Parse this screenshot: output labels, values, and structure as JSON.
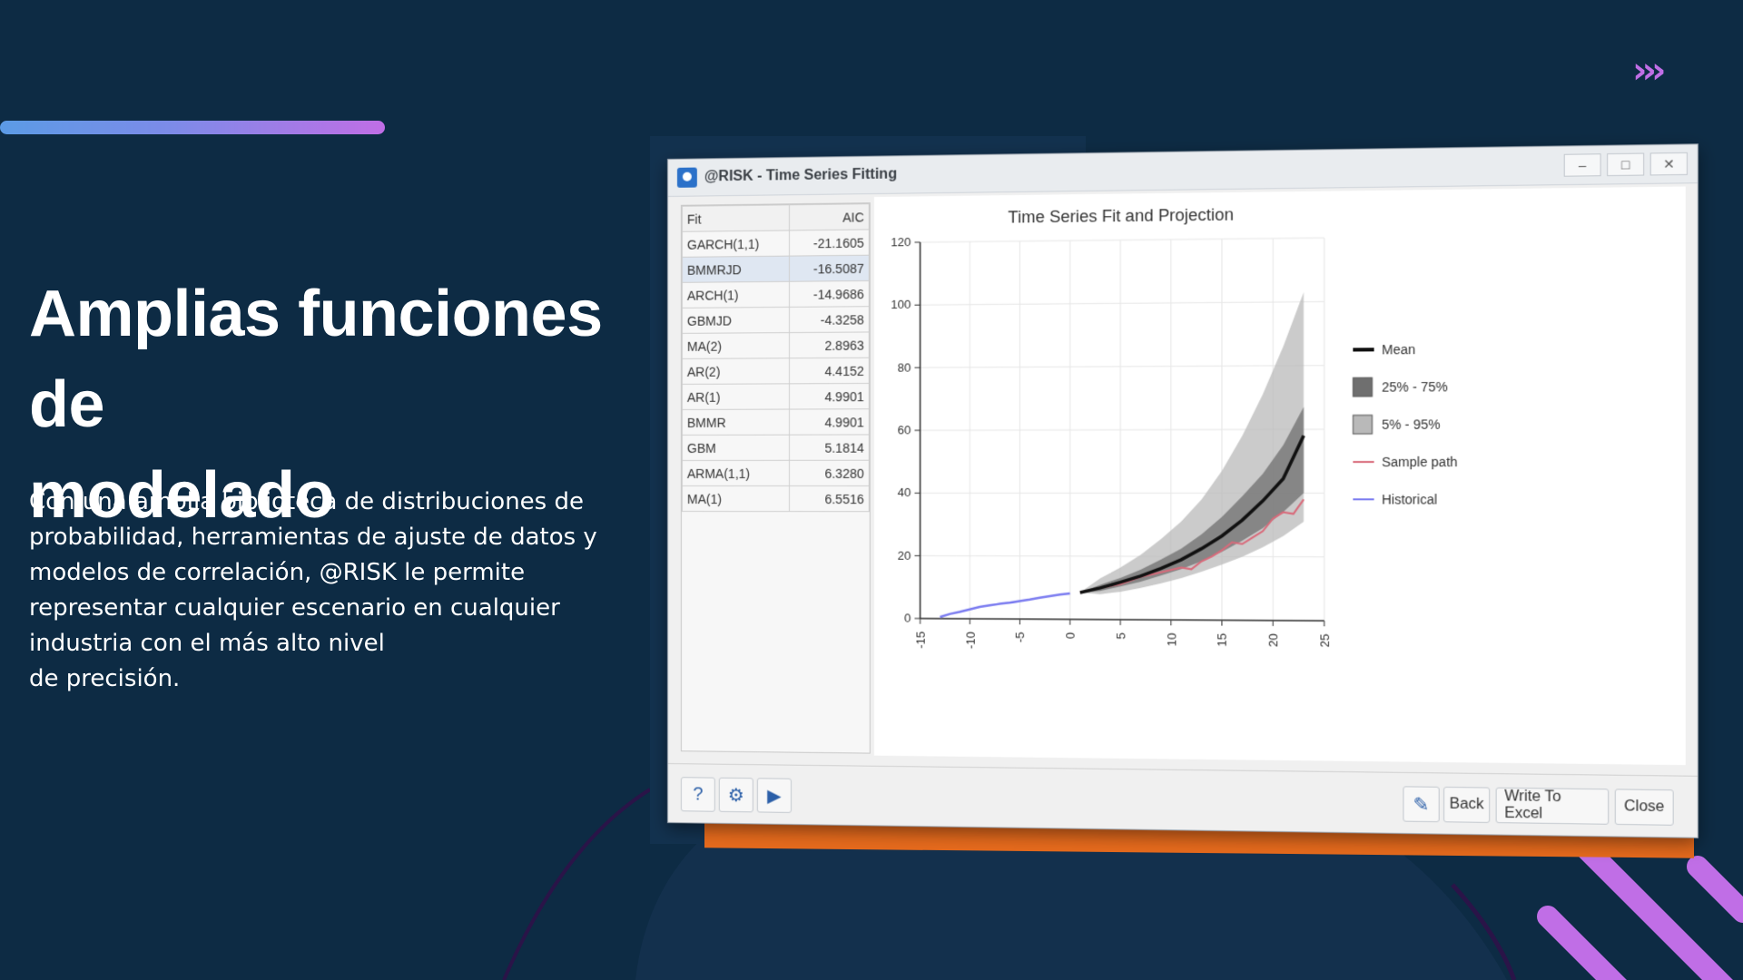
{
  "colors": {
    "background": "#0d2b44",
    "accent_gradient_start": "#5b9be6",
    "accent_gradient_end": "#c06ee6",
    "orange": "#e66a1c",
    "purple": "#c06ee6"
  },
  "decor": {
    "chevrons": "›››",
    "chevrons_icon": "triple-chevron-right-icon"
  },
  "headline": {
    "line1": "Amplias funciones de",
    "line2": "modelado"
  },
  "body": {
    "lines": [
      "Con una amplia biblioteca de distribuciones de",
      "probabilidad, herramientas de ajuste de datos y",
      "modelos de correlación, @RISK le permite",
      "representar cualquier escenario en cualquier",
      "industria con el más alto nivel",
      "de precisión."
    ]
  },
  "window": {
    "title": "@RISK - Time Series Fitting",
    "controls": {
      "minimize": "–",
      "maximize": "□",
      "close": "✕"
    },
    "fit_table": {
      "headers": [
        "Fit",
        "AIC"
      ],
      "rows": [
        [
          "GARCH(1,1)",
          "-21.1605"
        ],
        [
          "BMMRJD",
          "-16.5087"
        ],
        [
          "ARCH(1)",
          "-14.9686"
        ],
        [
          "GBMJD",
          "-4.3258"
        ],
        [
          "MA(2)",
          "2.8963"
        ],
        [
          "AR(2)",
          "4.4152"
        ],
        [
          "AR(1)",
          "4.9901"
        ],
        [
          "BMMR",
          "4.9901"
        ],
        [
          "GBM",
          "5.1814"
        ],
        [
          "ARMA(1,1)",
          "6.3280"
        ],
        [
          "MA(1)",
          "6.5516"
        ]
      ],
      "selected_index": 1
    },
    "toolbar": {
      "help_icon": "help-icon",
      "settings_icon": "gear-icon",
      "run_icon": "play-icon",
      "back": "Back",
      "write_excel": "Write To Excel",
      "close": "Close",
      "edit_icon": "edit-icon"
    }
  },
  "chart_data": {
    "type": "line",
    "title": "Time Series Fit and Projection",
    "xlim": [
      -15,
      25
    ],
    "ylim": [
      0,
      120
    ],
    "xticks": [
      -15,
      -10,
      -5,
      0,
      5,
      10,
      15,
      20,
      25
    ],
    "yticks": [
      0,
      20,
      40,
      60,
      80,
      100,
      120
    ],
    "grid": true,
    "legend": {
      "position": "right",
      "entries": [
        "Mean",
        "25% - 75%",
        "5% - 95%",
        "Sample path",
        "Historical"
      ]
    },
    "series": [
      {
        "name": "Historical",
        "color": "#7b7cf0",
        "x": [
          -13,
          -12,
          -11,
          -10,
          -9,
          -8,
          -7,
          -6,
          -5,
          -4,
          -3,
          -2,
          -1,
          0
        ],
        "y": [
          0.5,
          1.5,
          2.2,
          3,
          3.8,
          4.3,
          4.8,
          5.2,
          5.7,
          6.2,
          6.8,
          7.3,
          7.8,
          8.2
        ]
      },
      {
        "name": "Mean",
        "color": "#111111",
        "x": [
          1,
          3,
          5,
          7,
          9,
          11,
          13,
          15,
          17,
          19,
          21,
          23
        ],
        "y": [
          8.5,
          10,
          11.8,
          13.8,
          16.2,
          19,
          22.5,
          26.5,
          31.5,
          37.5,
          44.5,
          58
        ]
      },
      {
        "name": "Sample path",
        "color": "#d86a7a",
        "x": [
          1,
          3,
          5,
          7,
          9,
          11,
          12,
          13,
          14,
          15,
          16,
          17,
          18,
          19,
          20,
          21,
          22,
          23
        ],
        "y": [
          8.5,
          10,
          11.2,
          13.5,
          15,
          16.5,
          16,
          18.5,
          20,
          22,
          24.5,
          24,
          26,
          28,
          32,
          34,
          33.5,
          38
        ]
      },
      {
        "name": "25% - 75%",
        "color": "#6f6f6f",
        "x": [
          1,
          3,
          5,
          7,
          9,
          11,
          13,
          15,
          17,
          19,
          21,
          23
        ],
        "lower": [
          8.5,
          9,
          10.5,
          12,
          14,
          16,
          18.5,
          21.5,
          25,
          29,
          34,
          40
        ],
        "upper": [
          8.5,
          11,
          13.2,
          15.8,
          19,
          22.5,
          27,
          32.5,
          39,
          46,
          55,
          67
        ]
      },
      {
        "name": "5% - 95%",
        "color": "#b9b9b9",
        "x": [
          1,
          3,
          5,
          7,
          9,
          11,
          13,
          15,
          17,
          19,
          21,
          23
        ],
        "lower": [
          8.5,
          8,
          8.8,
          10,
          11.5,
          13.2,
          15.2,
          17.5,
          20,
          23,
          26.5,
          31
        ],
        "upper": [
          8.5,
          13,
          16.5,
          20.5,
          25.5,
          31,
          38,
          47,
          58,
          71,
          86,
          103
        ]
      }
    ]
  }
}
